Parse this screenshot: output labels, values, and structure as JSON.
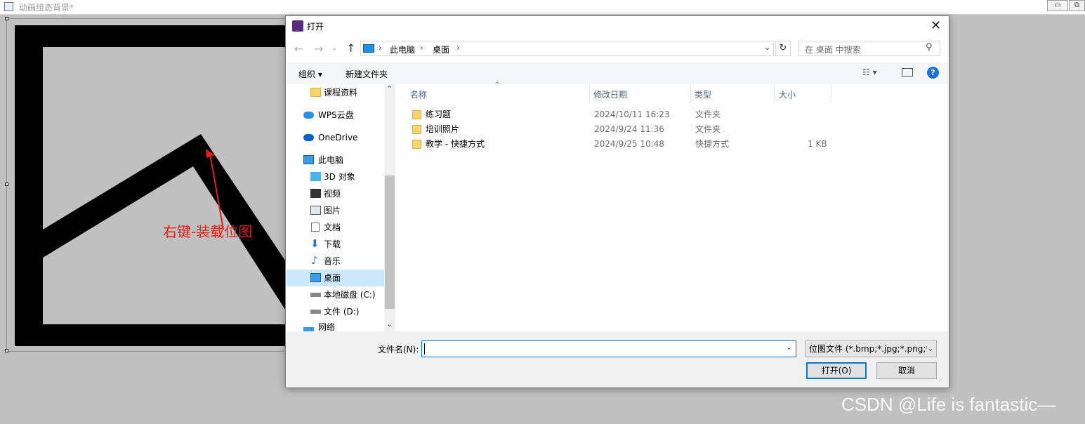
{
  "background_window": {
    "title": "动画组态背景*",
    "annotation": "右键-装载位图",
    "watermark": "CSDN @Life is fantastic—"
  },
  "dialog": {
    "title": "打开",
    "breadcrumb": [
      "此电脑",
      "桌面"
    ],
    "search_placeholder": "在 桌面 中搜索",
    "toolbar": {
      "organize": "组织 ▾",
      "new_folder": "新建文件夹"
    },
    "nav_items": [
      {
        "label": "课程资料",
        "icon": "folder-icon"
      },
      {
        "label": "WPS云盘",
        "icon": "cloud-icon"
      },
      {
        "label": "OneDrive",
        "icon": "cloud-icon"
      },
      {
        "label": "此电脑",
        "icon": "computer-icon"
      },
      {
        "label": "3D 对象",
        "icon": "cube-icon"
      },
      {
        "label": "视频",
        "icon": "video-icon"
      },
      {
        "label": "图片",
        "icon": "picture-icon"
      },
      {
        "label": "文档",
        "icon": "document-icon"
      },
      {
        "label": "下载",
        "icon": "download-icon"
      },
      {
        "label": "音乐",
        "icon": "music-icon"
      },
      {
        "label": "桌面",
        "icon": "desktop-icon"
      },
      {
        "label": "本地磁盘 (C:)",
        "icon": "drive-icon"
      },
      {
        "label": "文件 (D:)",
        "icon": "drive-icon"
      },
      {
        "label": "网络",
        "icon": "network-icon"
      }
    ],
    "columns": [
      "名称",
      "修改日期",
      "类型",
      "大小"
    ],
    "files": [
      {
        "name": "练习题",
        "date": "2024/10/11 16:23",
        "type": "文件夹",
        "size": ""
      },
      {
        "name": "培训照片",
        "date": "2024/9/24 11:36",
        "type": "文件夹",
        "size": ""
      },
      {
        "name": "教学 - 快捷方式",
        "date": "2024/9/25 10:48",
        "type": "快捷方式",
        "size": "1 KB"
      }
    ],
    "filename_label": "文件名(N):",
    "filename_value": "",
    "filter": "位图文件 (*.bmp;*.jpg;*.png;*",
    "open_button": "打开(O)",
    "cancel_button": "取消"
  },
  "colors": {
    "accent": "#0078d7",
    "annotation": "#e0201a",
    "selected": "#cce8ff"
  }
}
